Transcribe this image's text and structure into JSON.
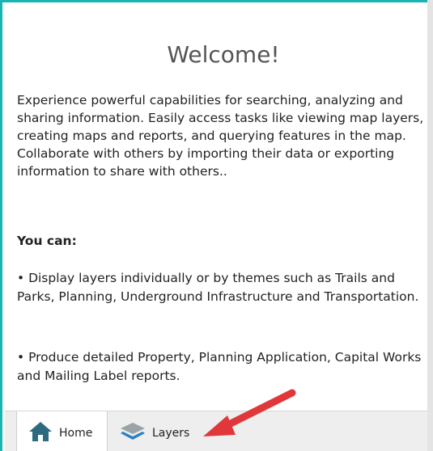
{
  "welcome": {
    "title": "Welcome!",
    "intro": "Experience powerful capabilities for searching, analyzing and sharing information. Easily access tasks like viewing map layers, creating maps and reports, and querying features in the map. Collaborate with others by importing their data or exporting information to share with others..",
    "you_can_heading": "You can:",
    "bullets": [
      "• Display layers individually or by themes such as Trails and Parks, Planning, Underground Infrastructure and Transportation.",
      "• Produce detailed Property, Planning Application, Capital Works and Mailing Label reports."
    ]
  },
  "tabs": {
    "home": {
      "label": "Home",
      "icon": "home-icon",
      "active": true
    },
    "layers": {
      "label": "Layers",
      "icon": "layers-icon",
      "active": false
    }
  },
  "colors": {
    "accent_border": "#16b4b3",
    "home_icon": "#2b6a7f",
    "layers_icon_top": "#9aa3a8",
    "layers_icon_bottom": "#2b80c4",
    "annotation_arrow": "#e0383a"
  }
}
